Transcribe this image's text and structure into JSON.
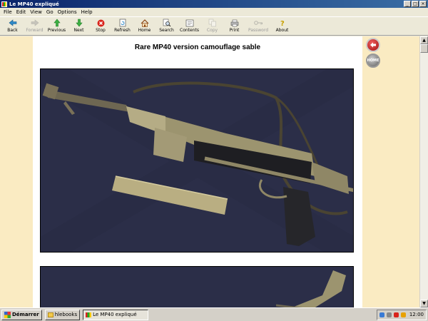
{
  "window": {
    "title": "Le MP40 expliqué",
    "controls": [
      "_",
      "□",
      "×"
    ]
  },
  "menubar": {
    "items": [
      "File",
      "Edit",
      "View",
      "Go",
      "Options",
      "Help"
    ]
  },
  "toolbar": {
    "buttons": [
      {
        "label": "Back",
        "icon": "back-arrow-icon",
        "enabled": true
      },
      {
        "label": "Forward",
        "icon": "forward-arrow-icon",
        "enabled": false
      },
      {
        "label": "Previous",
        "icon": "up-arrow-icon",
        "enabled": true
      },
      {
        "label": "Next",
        "icon": "down-arrow-icon",
        "enabled": true
      },
      {
        "label": "Stop",
        "icon": "stop-icon",
        "enabled": true
      },
      {
        "label": "Refresh",
        "icon": "refresh-icon",
        "enabled": true
      },
      {
        "label": "Home",
        "icon": "home-icon",
        "enabled": true
      },
      {
        "label": "Search",
        "icon": "search-icon",
        "enabled": true
      },
      {
        "label": "Contents",
        "icon": "contents-icon",
        "enabled": true
      },
      {
        "label": "Copy",
        "icon": "copy-icon",
        "enabled": false
      },
      {
        "label": "Print",
        "icon": "print-icon",
        "enabled": true
      },
      {
        "label": "Password",
        "icon": "key-icon",
        "enabled": false
      },
      {
        "label": "About",
        "icon": "about-icon",
        "enabled": true
      }
    ]
  },
  "page": {
    "title": "Rare MP40 version camouflage sable",
    "nav_home_label": "HOME"
  },
  "taskbar": {
    "start_label": "Démarrer",
    "tasks": [
      {
        "label": "hlebooks",
        "active": false
      },
      {
        "label": "Le MP40 expliqué",
        "active": true
      }
    ],
    "clock": "12:00"
  },
  "colors": {
    "page_background": "#FAEBC2",
    "photo_background": "#2B2E48",
    "titlebar": "#0A246A"
  }
}
